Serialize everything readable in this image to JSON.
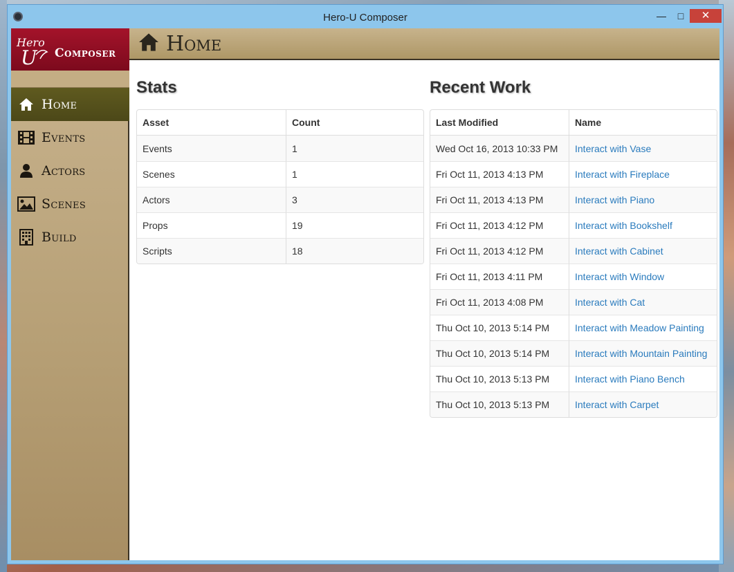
{
  "window": {
    "title": "Hero-U Composer",
    "controls": {
      "minimize": "—",
      "maximize": "□",
      "close": "✕"
    }
  },
  "logo": {
    "text": "Composer"
  },
  "sidebar": {
    "items": [
      {
        "label": "Home",
        "icon": "home-icon",
        "active": true
      },
      {
        "label": "Events",
        "icon": "film-icon",
        "active": false
      },
      {
        "label": "Actors",
        "icon": "user-icon",
        "active": false
      },
      {
        "label": "Scenes",
        "icon": "picture-icon",
        "active": false
      },
      {
        "label": "Build",
        "icon": "building-icon",
        "active": false
      }
    ]
  },
  "header": {
    "title": "Home",
    "icon": "home-icon"
  },
  "stats": {
    "title": "Stats",
    "columns": [
      "Asset",
      "Count"
    ],
    "rows": [
      [
        "Events",
        "1"
      ],
      [
        "Scenes",
        "1"
      ],
      [
        "Actors",
        "3"
      ],
      [
        "Props",
        "19"
      ],
      [
        "Scripts",
        "18"
      ]
    ]
  },
  "recent": {
    "title": "Recent Work",
    "columns": [
      "Last Modified",
      "Name"
    ],
    "rows": [
      [
        "Wed Oct 16, 2013 10:33 PM",
        "Interact with Vase"
      ],
      [
        "Fri Oct 11, 2013 4:13 PM",
        "Interact with Fireplace"
      ],
      [
        "Fri Oct 11, 2013 4:13 PM",
        "Interact with Piano"
      ],
      [
        "Fri Oct 11, 2013 4:12 PM",
        "Interact with Bookshelf"
      ],
      [
        "Fri Oct 11, 2013 4:12 PM",
        "Interact with Cabinet"
      ],
      [
        "Fri Oct 11, 2013 4:11 PM",
        "Interact with Window"
      ],
      [
        "Fri Oct 11, 2013 4:08 PM",
        "Interact with Cat"
      ],
      [
        "Thu Oct 10, 2013 5:14 PM",
        "Interact with Meadow Painting"
      ],
      [
        "Thu Oct 10, 2013 5:14 PM",
        "Interact with Mountain Painting"
      ],
      [
        "Thu Oct 10, 2013 5:13 PM",
        "Interact with Piano Bench"
      ],
      [
        "Thu Oct 10, 2013 5:13 PM",
        "Interact with Carpet"
      ]
    ]
  },
  "colors": {
    "logo_bg": "#9a1027",
    "nav_active": "#56521c",
    "sidebar_bg": "#b69f75",
    "link": "#2a7bbd",
    "titlebar": "#8dc6ec",
    "close_button": "#c7423a"
  }
}
